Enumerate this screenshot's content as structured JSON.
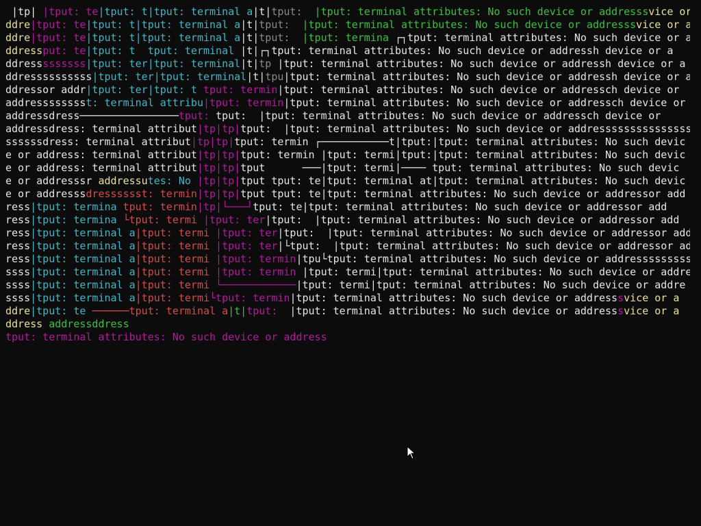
{
  "terminal": {
    "lines": [
      [
        {
          "t": " |tp| ",
          "c": "white"
        },
        {
          "t": "|tput: te",
          "c": "magenta"
        },
        {
          "t": "|tput: t",
          "c": "cyan"
        },
        {
          "t": "|tput: terminal a",
          "c": "cyan"
        },
        {
          "t": "|t|",
          "c": "white"
        },
        {
          "t": "tput: ",
          "c": "gray"
        },
        {
          "t": " |tput: terminal attributes: No such device or addresss",
          "c": "green"
        },
        {
          "t": "vice or a",
          "c": "yellow"
        }
      ],
      [
        {
          "t": "ddre",
          "c": "yellow"
        },
        {
          "t": "|tput: te",
          "c": "magenta"
        },
        {
          "t": "|tput: t",
          "c": "cyan"
        },
        {
          "t": "|tput: terminal a",
          "c": "cyan"
        },
        {
          "t": "|t|",
          "c": "white"
        },
        {
          "t": "tput: ",
          "c": "gray"
        },
        {
          "t": " |tput: terminal attributes: No such device or addresss",
          "c": "green"
        },
        {
          "t": "vice or a",
          "c": "yellow"
        }
      ],
      [
        {
          "t": "ddre",
          "c": "yellow"
        },
        {
          "t": "|tput: te",
          "c": "magenta"
        },
        {
          "t": "|tput: t",
          "c": "cyan"
        },
        {
          "t": "|tput: terminal a",
          "c": "cyan"
        },
        {
          "t": "|t|",
          "c": "white"
        },
        {
          "t": "tput: ",
          "c": "gray"
        },
        {
          "t": " |tput: termina",
          "c": "green"
        },
        {
          "t": " ┌┐tput: terminal attributes: No such device or a",
          "c": "white"
        }
      ],
      [
        {
          "t": "ddress",
          "c": "yellow"
        },
        {
          "t": "put: te",
          "c": "magenta"
        },
        {
          "t": "|tput: t",
          "c": "cyan"
        },
        {
          "t": "  tput: terminal",
          "c": "cyan"
        },
        {
          "t": " |t|┌┐",
          "c": "white"
        },
        {
          "t": "tput: terminal attributes: No such device or addressh device or a",
          "c": "white"
        }
      ],
      [
        {
          "t": "ddress",
          "c": "white"
        },
        {
          "t": "sssssss",
          "c": "magenta"
        },
        {
          "t": "|tput: ter",
          "c": "cyan"
        },
        {
          "t": "|tput: terminal",
          "c": "cyan"
        },
        {
          "t": "|t|",
          "c": "white"
        },
        {
          "t": "tp",
          "c": "gray"
        },
        {
          "t": " |tput: terminal attributes: No such device or addressh device or a",
          "c": "white"
        }
      ],
      [
        {
          "t": "ddressssssssss",
          "c": "white"
        },
        {
          "t": "|tput: ter",
          "c": "cyan"
        },
        {
          "t": "|tput: terminal",
          "c": "cyan"
        },
        {
          "t": "|t|",
          "c": "white"
        },
        {
          "t": "tpu",
          "c": "gray"
        },
        {
          "t": "|tput: terminal attributes: No such device or addressh device or a",
          "c": "white"
        }
      ],
      [
        {
          "t": "ddressor addr",
          "c": "white"
        },
        {
          "t": "|tput: ter",
          "c": "cyan"
        },
        {
          "t": "|tput: t",
          "c": "cyan"
        },
        {
          "t": " tput: termin",
          "c": "magenta"
        },
        {
          "t": "|tput: terminal attributes: No such device or addressch device or",
          "c": "white"
        }
      ],
      [
        {
          "t": "addressssssss",
          "c": "white"
        },
        {
          "t": "t: terminal attribu",
          "c": "cyan"
        },
        {
          "t": "|tput: termin",
          "c": "magenta"
        },
        {
          "t": "|tput: terminal attributes: No such device or addressch device or",
          "c": "white"
        }
      ],
      [
        {
          "t": "addressdress────────────────",
          "c": "white"
        },
        {
          "t": "tput: ",
          "c": "magenta"
        },
        {
          "t": "tput:  ",
          "c": "white"
        },
        {
          "t": "|tput: terminal attributes: No such device or addressch device or",
          "c": "white"
        }
      ],
      [
        {
          "t": "addressdress: terminal attribut",
          "c": "white"
        },
        {
          "t": "|tp|tp|",
          "c": "magenta"
        },
        {
          "t": "tput:  ",
          "c": "white"
        },
        {
          "t": "|tput: terminal attributes: No such device or addressssssssssssssss",
          "c": "white"
        }
      ],
      [
        {
          "t": "ssssssdress: terminal attribut",
          "c": "white"
        },
        {
          "t": "|tp|tp|",
          "c": "magenta"
        },
        {
          "t": "tput: termin ┌───────────t|tput:|tput: terminal attributes: No such devic",
          "c": "white"
        }
      ],
      [
        {
          "t": "e or address: terminal attribut",
          "c": "white"
        },
        {
          "t": "|tp|tp|",
          "c": "magenta"
        },
        {
          "t": "tput: termin |tput: termi|tput:|tput: terminal attributes: No such devic",
          "c": "white"
        }
      ],
      [
        {
          "t": "e or address: terminal attribut",
          "c": "white"
        },
        {
          "t": "|tp|tp|",
          "c": "magenta"
        },
        {
          "t": "tput      ───|tput: termi|──── tput: terminal attributes: No such devic",
          "c": "white"
        }
      ],
      [
        {
          "t": "e or addresssr ",
          "c": "white"
        },
        {
          "t": "addressu",
          "c": "yellow"
        },
        {
          "t": "tes: No ",
          "c": "cyan"
        },
        {
          "t": "|tp|tp|",
          "c": "magenta"
        },
        {
          "t": "tput tput: te|tput: terminal at|tput: terminal attributes: No such devic",
          "c": "white"
        }
      ],
      [
        {
          "t": "e or addresss",
          "c": "white"
        },
        {
          "t": "dresssssst: termin",
          "c": "red"
        },
        {
          "t": "|tp|tp|",
          "c": "magenta"
        },
        {
          "t": "tput ",
          "c": "white"
        },
        {
          "t": "tput: te|tput: terminal attributes: No such device or addressor add",
          "c": "white"
        }
      ],
      [
        {
          "t": "ress",
          "c": "white"
        },
        {
          "t": "|tput: termina ",
          "c": "cyan"
        },
        {
          "t": "tput: termin",
          "c": "red"
        },
        {
          "t": "|tp|└───┘",
          "c": "magenta"
        },
        {
          "t": "tput: te|tput: terminal attributes: No such device or addressor add",
          "c": "white"
        }
      ],
      [
        {
          "t": "ress",
          "c": "white"
        },
        {
          "t": "|tput: termina ",
          "c": "cyan"
        },
        {
          "t": "└tput: termi",
          "c": "red"
        },
        {
          "t": " |tput: ter",
          "c": "magenta"
        },
        {
          "t": "|tput:  |tput: terminal attributes: No such device or addressor add",
          "c": "white"
        }
      ],
      [
        {
          "t": "ress",
          "c": "white"
        },
        {
          "t": "|tput: terminal a",
          "c": "cyan"
        },
        {
          "t": "|tput: termi",
          "c": "red"
        },
        {
          "t": " |tput: ter",
          "c": "magenta"
        },
        {
          "t": "|tput:  |tput: terminal attributes: No such device or addressor add",
          "c": "white"
        }
      ],
      [
        {
          "t": "ress",
          "c": "white"
        },
        {
          "t": "|tput: terminal a",
          "c": "cyan"
        },
        {
          "t": "|tput: termi",
          "c": "red"
        },
        {
          "t": " |tput: ter",
          "c": "magenta"
        },
        {
          "t": "|└tput:  |tput: terminal attributes: No such device or addressor add",
          "c": "white"
        }
      ],
      [
        {
          "t": "ress",
          "c": "white"
        },
        {
          "t": "|tput: terminal a",
          "c": "cyan"
        },
        {
          "t": "|tput: termi",
          "c": "red"
        },
        {
          "t": " |tput: termin",
          "c": "magenta"
        },
        {
          "t": "|tpu└tput: terminal attributes: No such device or addressssssssss",
          "c": "white"
        }
      ],
      [
        {
          "t": "ssss",
          "c": "white"
        },
        {
          "t": "|tput: terminal a",
          "c": "cyan"
        },
        {
          "t": "|tput: termi",
          "c": "red"
        },
        {
          "t": " |tput: termin",
          "c": "magenta"
        },
        {
          "t": " |tput: termi|tput: terminal attributes: No such device or addre",
          "c": "white"
        }
      ],
      [
        {
          "t": "ssss",
          "c": "white"
        },
        {
          "t": "|tput: terminal a",
          "c": "cyan"
        },
        {
          "t": "|tput: termi",
          "c": "red"
        },
        {
          "t": " └────────────",
          "c": "magenta"
        },
        {
          "t": "|tput: termi|tput: terminal attributes: No such device or addre",
          "c": "white"
        }
      ],
      [
        {
          "t": "ssss",
          "c": "white"
        },
        {
          "t": "|tput: terminal a",
          "c": "cyan"
        },
        {
          "t": "|tput: termi",
          "c": "red"
        },
        {
          "t": "└tput: termin",
          "c": "magenta"
        },
        {
          "t": "|tput: terminal attributes: No such device or address",
          "c": "white"
        },
        {
          "t": "s",
          "c": "magenta"
        },
        {
          "t": "vice or a",
          "c": "yellow"
        }
      ],
      [
        {
          "t": "ddre",
          "c": "yellow"
        },
        {
          "t": "|tput: te",
          "c": "cyan"
        },
        {
          "t": " ──────",
          "c": "red"
        },
        {
          "t": "tput: terminal a",
          "c": "red"
        },
        {
          "t": "|t|",
          "c": "green"
        },
        {
          "t": "tput: ",
          "c": "magenta"
        },
        {
          "t": " |tput: terminal attributes: No such device or address",
          "c": "white"
        },
        {
          "t": "s",
          "c": "magenta"
        },
        {
          "t": "vice or a",
          "c": "yellow"
        }
      ],
      [
        {
          "t": "ddress ",
          "c": "yellow"
        },
        {
          "t": "addressddress",
          "c": "green"
        }
      ],
      [
        {
          "t": "tput: terminal attributes: No such device or address",
          "c": "magenta"
        }
      ]
    ]
  },
  "cursor": {
    "icon": "mouse-pointer-icon"
  }
}
